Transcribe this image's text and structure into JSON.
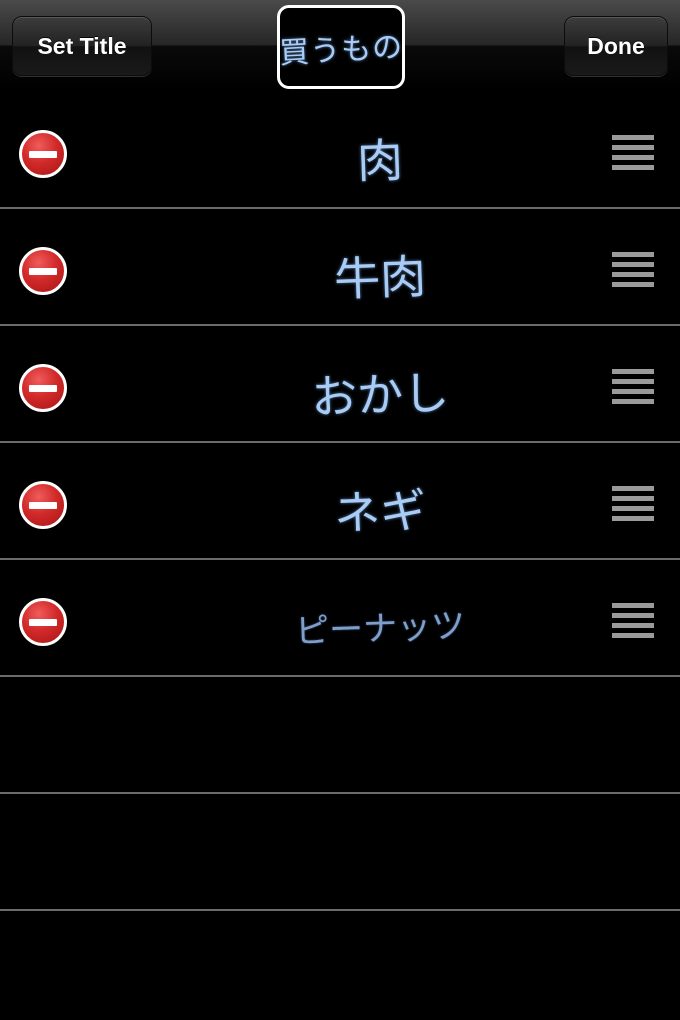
{
  "navbar": {
    "left_button": "Set Title",
    "title": "買うもの",
    "right_button": "Done"
  },
  "list": {
    "items": [
      {
        "text": "肉"
      },
      {
        "text": "牛肉"
      },
      {
        "text": "おかし"
      },
      {
        "text": "ネギ"
      },
      {
        "text": "ピーナッツ"
      }
    ],
    "icons": {
      "delete": "minus-circle-icon",
      "reorder": "reorder-grip-icon"
    }
  },
  "colors": {
    "background": "#000000",
    "handwriting": "#a9ccf5",
    "delete_red": "#d22a2a",
    "separator": "#6b6b6b",
    "grip": "#9a9a9a"
  }
}
